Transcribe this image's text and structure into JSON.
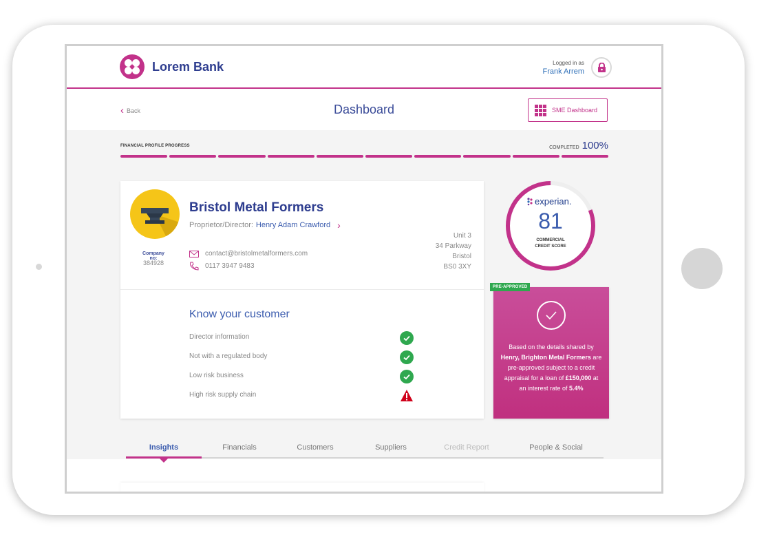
{
  "header": {
    "brand": "Lorem Bank",
    "logged_in_label": "Logged in as",
    "user_name": "Frank Arrem"
  },
  "subheader": {
    "back_label": "Back",
    "title": "Dashboard",
    "sme_button_label": "SME Dashboard"
  },
  "progress": {
    "label": "FINANCIAL PROFILE PROGRESS",
    "completed_label": "COMPLETED",
    "percent": "100%",
    "segments": 10,
    "fraction": 1.0
  },
  "company": {
    "name": "Bristol Metal Formers",
    "director_label": "Proprietor/Director:",
    "director_name": "Henry Adam Crawford",
    "company_no_label": "Company no:",
    "company_no": "384928",
    "email": "contact@bristolmetalformers.com",
    "phone": "0117 3947 9483",
    "address": [
      "Unit 3",
      "34 Parkway",
      "Bristol",
      "BS0 3XY"
    ]
  },
  "kyc": {
    "title": "Know your customer",
    "items": [
      {
        "label": "Director information",
        "status": "ok"
      },
      {
        "label": "Not with a regulated body",
        "status": "ok"
      },
      {
        "label": "Low risk business",
        "status": "ok"
      },
      {
        "label": "High risk supply chain",
        "status": "warning"
      }
    ]
  },
  "credit": {
    "provider": "experian.",
    "score": "81",
    "score_fraction": 0.81,
    "label_line1": "COMMERCIAL",
    "label_line2": "CREDIT SCORE"
  },
  "approval": {
    "badge": "PRE-APPROVED",
    "text_1": "Based on the details shared by ",
    "text_bold_1": "Henry, Brighton Metal Formers",
    "text_2": " are pre-approved subject to a credit appraisal for a loan of ",
    "text_bold_2": "£150,000",
    "text_3": " at an interest rate of ",
    "text_bold_3": "5.4%"
  },
  "tabs": [
    {
      "label": "Insights",
      "state": "active"
    },
    {
      "label": "Financials",
      "state": "normal"
    },
    {
      "label": "Customers",
      "state": "normal"
    },
    {
      "label": "Suppliers",
      "state": "normal"
    },
    {
      "label": "Credit Report",
      "state": "disabled"
    },
    {
      "label": "People & Social",
      "state": "normal"
    }
  ],
  "colors": {
    "brand": "#c2328a",
    "primary_text": "#2e3d8f",
    "ok": "#2fa84f",
    "warning": "#d0021b"
  }
}
